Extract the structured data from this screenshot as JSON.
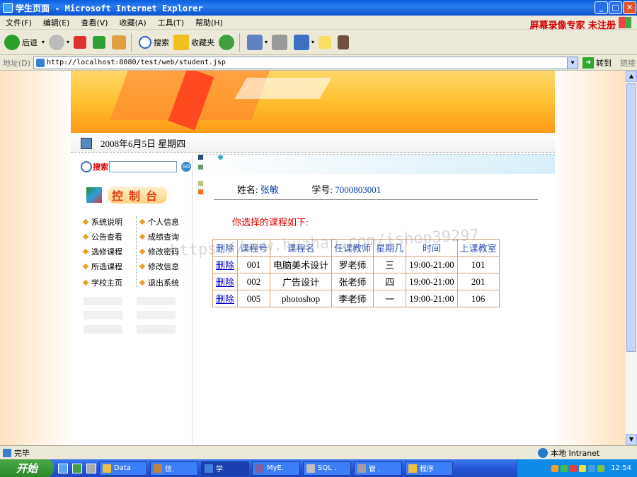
{
  "window": {
    "title": "学生页面 - Microsoft Internet Explorer",
    "recorder_badge": "屏幕录像专家 未注册",
    "minimize": "_",
    "maximize": "□",
    "close": "✕"
  },
  "menu": [
    "文件(F)",
    "编辑(E)",
    "查看(V)",
    "收藏(A)",
    "工具(T)",
    "帮助(H)"
  ],
  "toolbar": {
    "back_label": "后退",
    "search_label": "搜索",
    "favorites_label": "收藏夹"
  },
  "address": {
    "label": "地址(D)",
    "url": "http://localhost:8080/test/web/student.jsp",
    "go_label": "转到",
    "links_label": "链接"
  },
  "page": {
    "date": "2008年6月5日  星期四",
    "search_label": "搜索",
    "search_value": "",
    "search_go": "GO",
    "control_panel": "控制台",
    "nav_left": [
      "系统说明",
      "公告查看",
      "选修课程",
      "所选课程",
      "学校主页"
    ],
    "nav_right": [
      "个人信息",
      "成绩查询",
      "修改密码",
      "修改信息",
      "退出系统"
    ],
    "name_label": "姓名:",
    "name_value": "张敏",
    "id_label": "学号:",
    "id_value": "7000803001",
    "heading": "你选择的课程如下:",
    "table_headers": [
      "删除",
      "课程号",
      "课程名",
      "任课教师",
      "星期几",
      "时间",
      "上课教室"
    ],
    "rows": [
      [
        "删除",
        "001",
        "电脑美术设计",
        "罗老师",
        "三",
        "19:00-21:00",
        "101"
      ],
      [
        "删除",
        "002",
        "广告设计",
        "张老师",
        "四",
        "19:00-21:00",
        "201"
      ],
      [
        "删除",
        "005",
        "photoshop",
        "李老师",
        "一",
        "19:00-21:00",
        "106"
      ]
    ]
  },
  "watermark": "https://www.huzhan.com/ishop39297",
  "status": {
    "text": "完毕",
    "zone": "本地 Intranet"
  },
  "taskbar": {
    "start": "开始",
    "tasks": [
      "Data",
      "信.",
      "学",
      "MyE.",
      "SQL .",
      "管 .",
      "程序"
    ],
    "clock": "12:54"
  }
}
